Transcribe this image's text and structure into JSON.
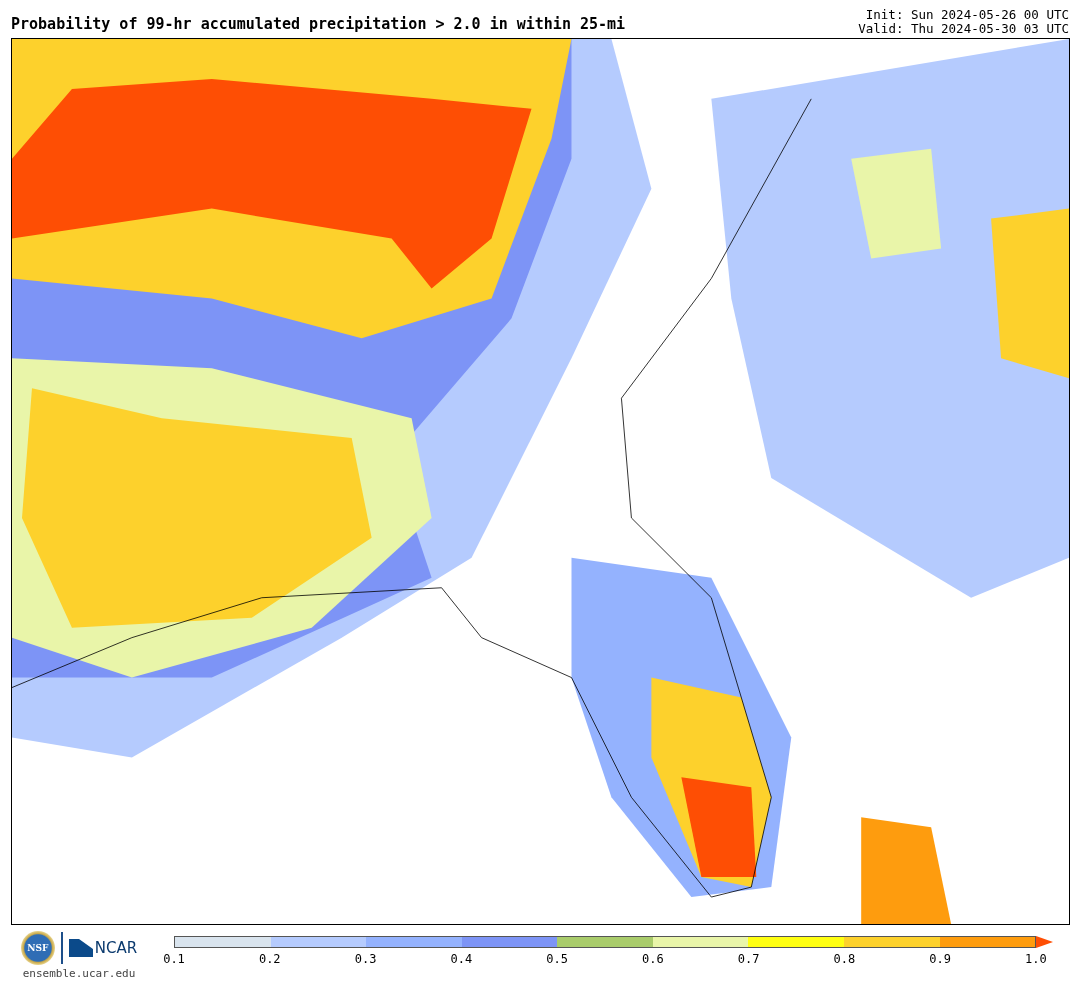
{
  "title": "Probability of 99-hr accumulated precipitation > 2.0 in within 25-mi",
  "init": "Init: Sun 2024-05-26 00 UTC",
  "valid": "Valid: Thu 2024-05-30 03 UTC",
  "logos": {
    "nsf": "NSF",
    "ncar": "NCAR",
    "url": "ensemble.ucar.edu"
  },
  "colorbar": {
    "segments": [
      {
        "color": "#d9e4ee"
      },
      {
        "color": "#b5cbfe"
      },
      {
        "color": "#94b2fe"
      },
      {
        "color": "#7d94f6"
      },
      {
        "color": "#a9cc6b"
      },
      {
        "color": "#e9f5a9"
      },
      {
        "color": "#ffff12"
      },
      {
        "color": "#fdd12c"
      },
      {
        "color": "#fe9c0e"
      }
    ],
    "extend": {
      "color": "#fe4e04"
    },
    "labels": [
      "0.1",
      "0.2",
      "0.3",
      "0.4",
      "0.5",
      "0.6",
      "0.7",
      "0.8",
      "0.9",
      "1.0"
    ]
  }
}
